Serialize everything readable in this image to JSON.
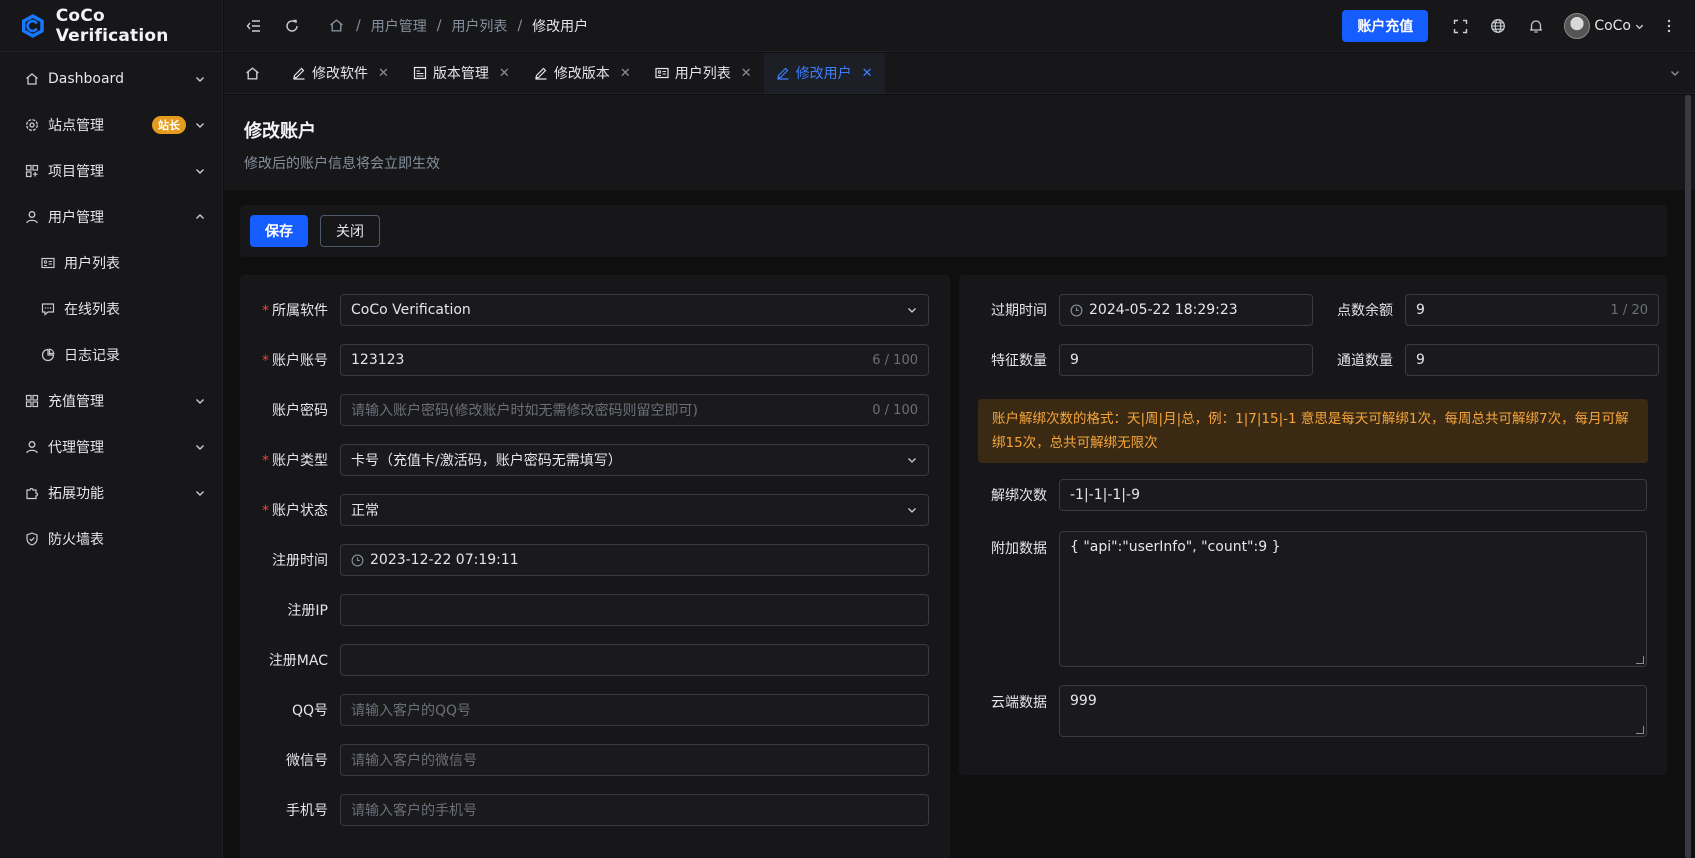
{
  "app": {
    "name": "CoCo Verification"
  },
  "sidebar": {
    "items": [
      {
        "label": "Dashboard",
        "icon": "home-icon",
        "expanded": false
      },
      {
        "label": "站点管理",
        "icon": "settings-icon",
        "badge": "站长",
        "expanded": false
      },
      {
        "label": "项目管理",
        "icon": "grid-icon",
        "expanded": false
      },
      {
        "label": "用户管理",
        "icon": "user-icon",
        "expanded": true
      },
      {
        "label": "用户列表",
        "icon": "id-card-icon",
        "sub": true
      },
      {
        "label": "在线列表",
        "icon": "chat-icon",
        "sub": true
      },
      {
        "label": "日志记录",
        "icon": "pie-chart-icon",
        "sub": true
      },
      {
        "label": "充值管理",
        "icon": "apps-icon",
        "expanded": false
      },
      {
        "label": "代理管理",
        "icon": "user-icon",
        "expanded": false
      },
      {
        "label": "拓展功能",
        "icon": "extension-icon",
        "expanded": false
      },
      {
        "label": "防火墙表",
        "icon": "shield-icon"
      }
    ]
  },
  "header": {
    "breadcrumb": [
      "用户管理",
      "用户列表",
      "修改用户"
    ],
    "recharge_label": "账户充值",
    "username": "CoCo"
  },
  "tabs": [
    {
      "label": "修改软件",
      "icon": "edit-icon"
    },
    {
      "label": "版本管理",
      "icon": "image-icon"
    },
    {
      "label": "修改版本",
      "icon": "edit-icon"
    },
    {
      "label": "用户列表",
      "icon": "id-card-icon"
    },
    {
      "label": "修改用户",
      "icon": "edit-icon",
      "active": true
    }
  ],
  "page": {
    "title": "修改账户",
    "subtitle": "修改后的账户信息将会立即生效",
    "save_label": "保存",
    "close_label": "关闭"
  },
  "form_left": {
    "software": {
      "label": "所属软件",
      "value": "CoCo Verification"
    },
    "account": {
      "label": "账户账号",
      "value": "123123",
      "count": "6 / 100"
    },
    "password": {
      "label": "账户密码",
      "placeholder": "请输入账户密码(修改账户时如无需修改密码则留空即可)",
      "count": "0 / 100"
    },
    "type": {
      "label": "账户类型",
      "value": "卡号（充值卡/激活码，账户密码无需填写）"
    },
    "status": {
      "label": "账户状态",
      "value": "正常"
    },
    "reg_time": {
      "label": "注册时间",
      "value": "2023-12-22 07:19:11"
    },
    "reg_ip": {
      "label": "注册IP",
      "value": ""
    },
    "reg_mac": {
      "label": "注册MAC",
      "value": ""
    },
    "qq": {
      "label": "QQ号",
      "placeholder": "请输入客户的QQ号"
    },
    "wechat": {
      "label": "微信号",
      "placeholder": "请输入客户的微信号"
    },
    "phone": {
      "label": "手机号",
      "placeholder": "请输入客户的手机号"
    }
  },
  "form_right": {
    "expire": {
      "label": "过期时间",
      "value": "2024-05-22 18:29:23"
    },
    "points": {
      "label": "点数余额",
      "value": "9",
      "count": "1 / 20"
    },
    "features": {
      "label": "特征数量",
      "value": "9"
    },
    "channels": {
      "label": "通道数量",
      "value": "9"
    },
    "alert": "账户解绑次数的格式：天|周|月|总，例：1|7|15|-1 意思是每天可解绑1次，每周总共可解绑7次，每月可解绑15次，总共可解绑无限次",
    "unbind": {
      "label": "解绑次数",
      "value": "-1|-1|-1|-9"
    },
    "extra": {
      "label": "附加数据",
      "value": "{ \"api\":\"userInfo\", \"count\":9 }"
    },
    "cloud": {
      "label": "云端数据",
      "value": "999"
    }
  },
  "colors": {
    "primary": "#165dff",
    "warning": "#f7a53a",
    "badge": "#e59b1e",
    "required": "#f53f3f"
  }
}
